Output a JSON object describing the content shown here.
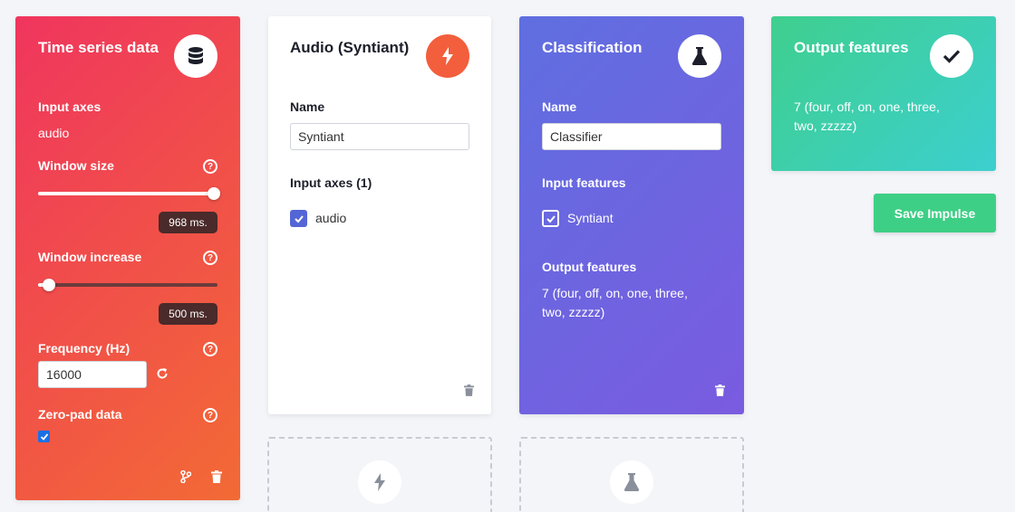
{
  "colors": {
    "time_series_gradient": [
      "#f0355e",
      "#f26a35"
    ],
    "classification_gradient": [
      "#5f6fe0",
      "#7a5be0"
    ],
    "output_gradient": [
      "#3fcf8e",
      "#3ccfcf"
    ],
    "orange_accent": "#f35e3c",
    "save_green": "#3ecf86",
    "checkbox_blue": "#5466d6"
  },
  "time_series": {
    "title": "Time series data",
    "icon": "database-icon",
    "input_axes_label": "Input axes",
    "input_axes_value": "audio",
    "window_size_label": "Window size",
    "window_size_value": "968 ms.",
    "window_size_level": 1.0,
    "window_increase_label": "Window increase",
    "window_increase_value": "500 ms.",
    "window_increase_level": 0.06,
    "frequency_label": "Frequency (Hz)",
    "frequency_value": "16000",
    "zero_pad_label": "Zero-pad data",
    "zero_pad_checked": true,
    "help_glyph": "?"
  },
  "audio_block": {
    "title": "Audio (Syntiant)",
    "icon": "lightning-icon",
    "name_label": "Name",
    "name_value": "Syntiant",
    "input_axes_label": "Input axes (1)",
    "axis_item": "audio"
  },
  "classification": {
    "title": "Classification",
    "icon": "flask-icon",
    "name_label": "Name",
    "name_value": "Classifier",
    "input_features_label": "Input features",
    "input_feature_item": "Syntiant",
    "output_features_label": "Output features",
    "output_features_value_line1": "7 (four, off, on, one, three,",
    "output_features_value_line2": "two, zzzzz)"
  },
  "output": {
    "title": "Output features",
    "icon": "checkmark-icon",
    "value_line1": "7 (four, off, on, one, three,",
    "value_line2": "two, zzzzz)"
  },
  "save_button": "Save Impulse"
}
